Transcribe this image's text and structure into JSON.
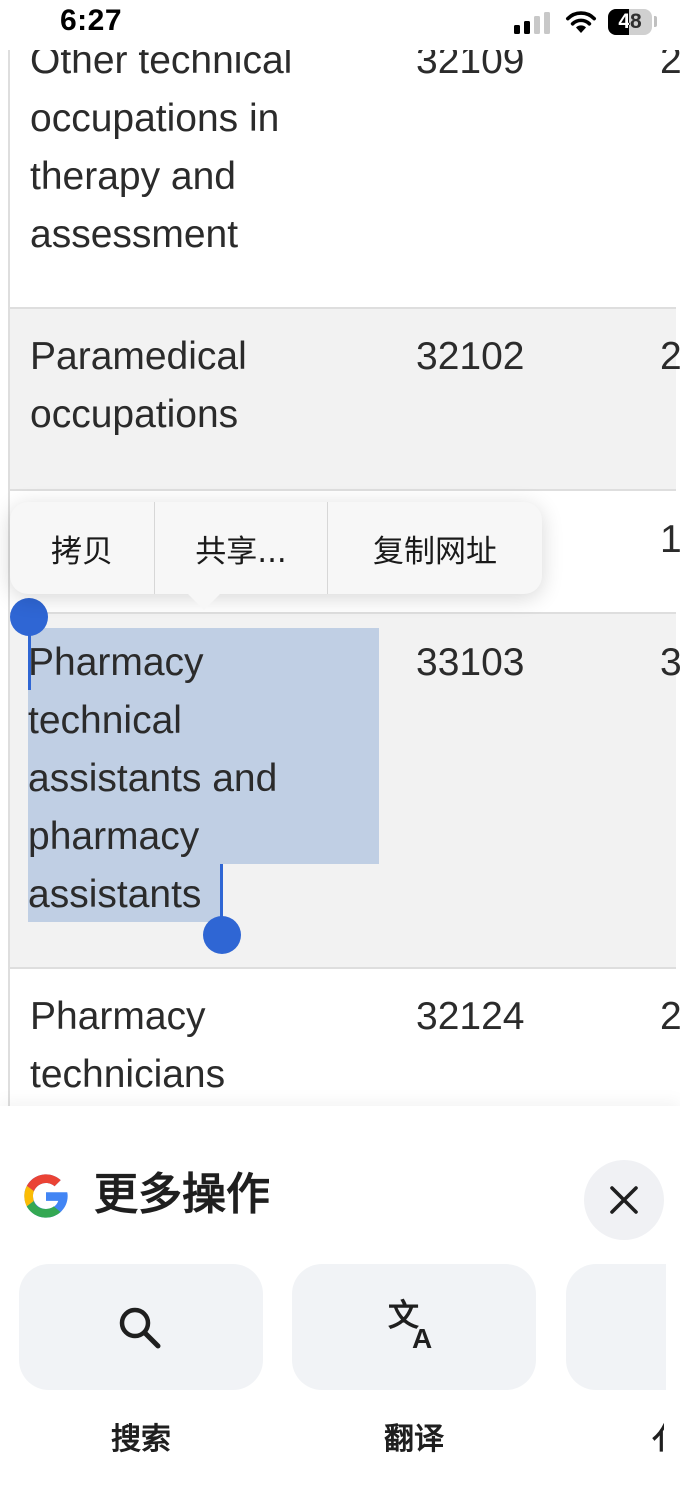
{
  "status_bar": {
    "time": "6:27",
    "battery": "48"
  },
  "table": {
    "rows": [
      {
        "name_lines": [
          "Other technical",
          "occupations in",
          "therapy and",
          "assessment"
        ],
        "code": "32109",
        "more": "2"
      },
      {
        "name_lines": [
          "Paramedical",
          "occupations"
        ],
        "code": "32102",
        "more": "2"
      },
      {
        "name_lines": [
          ""
        ],
        "code": "",
        "more": "1"
      },
      {
        "name_lines": [
          "Pharmacy",
          "technical",
          "assistants and",
          "pharmacy",
          "assistants"
        ],
        "code": "33103",
        "more": "3"
      },
      {
        "name_lines": [
          "Pharmacy",
          "technicians"
        ],
        "code": "32124",
        "more": "2"
      }
    ]
  },
  "context_menu": {
    "copy": "拷贝",
    "share": "共享...",
    "copy_url": "复制网址"
  },
  "sheet": {
    "title": "更多操作",
    "actions": [
      {
        "label": "搜索",
        "icon": "search-icon"
      },
      {
        "label": "翻译",
        "icon": "translate-icon"
      },
      {
        "label": "d",
        "icon": ""
      }
    ]
  }
}
